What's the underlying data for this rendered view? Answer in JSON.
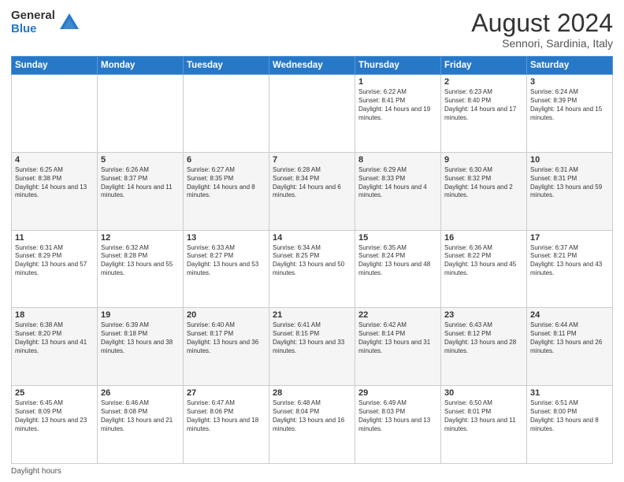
{
  "logo": {
    "general": "General",
    "blue": "Blue"
  },
  "title": "August 2024",
  "subtitle": "Sennori, Sardinia, Italy",
  "days_of_week": [
    "Sunday",
    "Monday",
    "Tuesday",
    "Wednesday",
    "Thursday",
    "Friday",
    "Saturday"
  ],
  "footer": "Daylight hours",
  "weeks": [
    [
      {
        "day": "",
        "info": ""
      },
      {
        "day": "",
        "info": ""
      },
      {
        "day": "",
        "info": ""
      },
      {
        "day": "",
        "info": ""
      },
      {
        "day": "1",
        "info": "Sunrise: 6:22 AM\nSunset: 8:41 PM\nDaylight: 14 hours and 19 minutes."
      },
      {
        "day": "2",
        "info": "Sunrise: 6:23 AM\nSunset: 8:40 PM\nDaylight: 14 hours and 17 minutes."
      },
      {
        "day": "3",
        "info": "Sunrise: 6:24 AM\nSunset: 8:39 PM\nDaylight: 14 hours and 15 minutes."
      }
    ],
    [
      {
        "day": "4",
        "info": "Sunrise: 6:25 AM\nSunset: 8:38 PM\nDaylight: 14 hours and 13 minutes."
      },
      {
        "day": "5",
        "info": "Sunrise: 6:26 AM\nSunset: 8:37 PM\nDaylight: 14 hours and 11 minutes."
      },
      {
        "day": "6",
        "info": "Sunrise: 6:27 AM\nSunset: 8:35 PM\nDaylight: 14 hours and 8 minutes."
      },
      {
        "day": "7",
        "info": "Sunrise: 6:28 AM\nSunset: 8:34 PM\nDaylight: 14 hours and 6 minutes."
      },
      {
        "day": "8",
        "info": "Sunrise: 6:29 AM\nSunset: 8:33 PM\nDaylight: 14 hours and 4 minutes."
      },
      {
        "day": "9",
        "info": "Sunrise: 6:30 AM\nSunset: 8:32 PM\nDaylight: 14 hours and 2 minutes."
      },
      {
        "day": "10",
        "info": "Sunrise: 6:31 AM\nSunset: 8:31 PM\nDaylight: 13 hours and 59 minutes."
      }
    ],
    [
      {
        "day": "11",
        "info": "Sunrise: 6:31 AM\nSunset: 8:29 PM\nDaylight: 13 hours and 57 minutes."
      },
      {
        "day": "12",
        "info": "Sunrise: 6:32 AM\nSunset: 8:28 PM\nDaylight: 13 hours and 55 minutes."
      },
      {
        "day": "13",
        "info": "Sunrise: 6:33 AM\nSunset: 8:27 PM\nDaylight: 13 hours and 53 minutes."
      },
      {
        "day": "14",
        "info": "Sunrise: 6:34 AM\nSunset: 8:25 PM\nDaylight: 13 hours and 50 minutes."
      },
      {
        "day": "15",
        "info": "Sunrise: 6:35 AM\nSunset: 8:24 PM\nDaylight: 13 hours and 48 minutes."
      },
      {
        "day": "16",
        "info": "Sunrise: 6:36 AM\nSunset: 8:22 PM\nDaylight: 13 hours and 45 minutes."
      },
      {
        "day": "17",
        "info": "Sunrise: 6:37 AM\nSunset: 8:21 PM\nDaylight: 13 hours and 43 minutes."
      }
    ],
    [
      {
        "day": "18",
        "info": "Sunrise: 6:38 AM\nSunset: 8:20 PM\nDaylight: 13 hours and 41 minutes."
      },
      {
        "day": "19",
        "info": "Sunrise: 6:39 AM\nSunset: 8:18 PM\nDaylight: 13 hours and 38 minutes."
      },
      {
        "day": "20",
        "info": "Sunrise: 6:40 AM\nSunset: 8:17 PM\nDaylight: 13 hours and 36 minutes."
      },
      {
        "day": "21",
        "info": "Sunrise: 6:41 AM\nSunset: 8:15 PM\nDaylight: 13 hours and 33 minutes."
      },
      {
        "day": "22",
        "info": "Sunrise: 6:42 AM\nSunset: 8:14 PM\nDaylight: 13 hours and 31 minutes."
      },
      {
        "day": "23",
        "info": "Sunrise: 6:43 AM\nSunset: 8:12 PM\nDaylight: 13 hours and 28 minutes."
      },
      {
        "day": "24",
        "info": "Sunrise: 6:44 AM\nSunset: 8:11 PM\nDaylight: 13 hours and 26 minutes."
      }
    ],
    [
      {
        "day": "25",
        "info": "Sunrise: 6:45 AM\nSunset: 8:09 PM\nDaylight: 13 hours and 23 minutes."
      },
      {
        "day": "26",
        "info": "Sunrise: 6:46 AM\nSunset: 8:08 PM\nDaylight: 13 hours and 21 minutes."
      },
      {
        "day": "27",
        "info": "Sunrise: 6:47 AM\nSunset: 8:06 PM\nDaylight: 13 hours and 18 minutes."
      },
      {
        "day": "28",
        "info": "Sunrise: 6:48 AM\nSunset: 8:04 PM\nDaylight: 13 hours and 16 minutes."
      },
      {
        "day": "29",
        "info": "Sunrise: 6:49 AM\nSunset: 8:03 PM\nDaylight: 13 hours and 13 minutes."
      },
      {
        "day": "30",
        "info": "Sunrise: 6:50 AM\nSunset: 8:01 PM\nDaylight: 13 hours and 11 minutes."
      },
      {
        "day": "31",
        "info": "Sunrise: 6:51 AM\nSunset: 8:00 PM\nDaylight: 13 hours and 8 minutes."
      }
    ]
  ]
}
